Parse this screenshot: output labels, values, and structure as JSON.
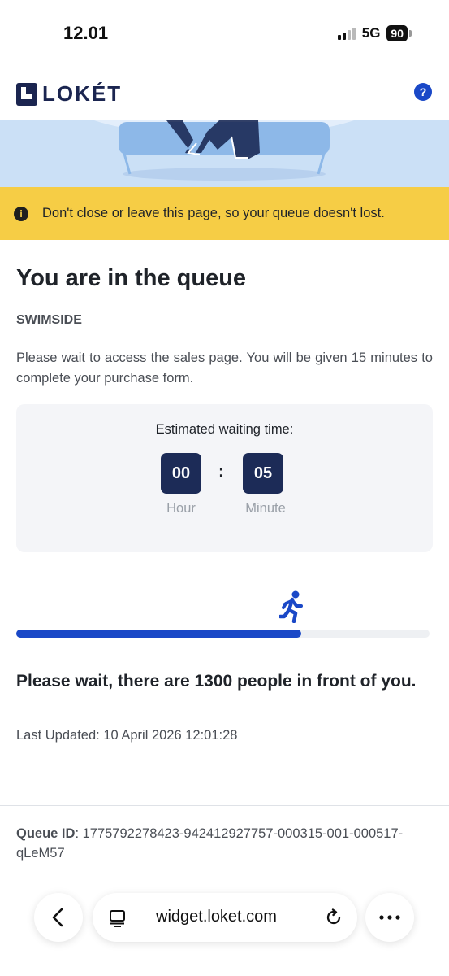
{
  "status": {
    "time": "12.01",
    "network": "5G",
    "battery": "90"
  },
  "header": {
    "logo_text": "LOKÉT",
    "help_label": "?"
  },
  "warning": {
    "icon": "info-icon",
    "glyph": "i",
    "text": "Don't close or leave this page, so your queue doesn't lost."
  },
  "main": {
    "title": "You are in the queue",
    "event": "SWIMSIDE",
    "description": "Please wait to access the sales page. You will be given 15 minutes to complete your purchase form."
  },
  "wait": {
    "label": "Estimated waiting time:",
    "hours": "00",
    "separator": ":",
    "minutes": "05",
    "hour_label": "Hour",
    "minute_label": "Minute"
  },
  "progress": {
    "fraction": 0.69,
    "icon": "runner-icon"
  },
  "queue": {
    "people_text": "Please wait, there are 1300 people in front of you.",
    "last_updated": "Last Updated: 10 April 2026 12:01:28",
    "id_label": "Queue ID",
    "id_value": ": 1775792278423-942412927757-000315-001-000517-qLeM57"
  },
  "browser": {
    "url": "widget.loket.com"
  },
  "colors": {
    "accent": "#1a48c7",
    "warning": "#f6cd45",
    "navy": "#1c2b57"
  }
}
